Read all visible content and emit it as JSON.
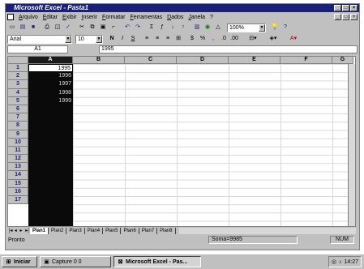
{
  "window": {
    "title": "Microsoft Excel - Pasta1"
  },
  "menu": [
    "Arquivo",
    "Editar",
    "Exibir",
    "Inserir",
    "Formatar",
    "Ferramentas",
    "Dados",
    "Janela",
    "?"
  ],
  "toolbar": {
    "standard_icons": [
      "new-icon",
      "open-icon",
      "save-icon",
      "print-icon",
      "preview-icon",
      "spell-icon",
      "cut-icon",
      "copy-icon",
      "paste-icon",
      "format-painter-icon",
      "undo-icon",
      "redo-icon",
      "autosum-icon",
      "function-icon",
      "sort-asc-icon",
      "sort-desc-icon",
      "chart-wizard-icon",
      "map-icon",
      "drawing-icon"
    ],
    "zoom": "100%",
    "font": "Arial",
    "font_size": "10"
  },
  "formula": {
    "name_box": "A1",
    "value": "1995"
  },
  "columns": [
    "A",
    "B",
    "C",
    "D",
    "E",
    "F",
    "G"
  ],
  "rows": [
    "1",
    "2",
    "3",
    "4",
    "5",
    "6",
    "7",
    "8",
    "9",
    "10",
    "11",
    "12",
    "13",
    "14",
    "15",
    "16",
    "17"
  ],
  "cells_a": [
    "1995",
    "1996",
    "1997",
    "1998",
    "1999"
  ],
  "sheets": [
    "Plan1",
    "Plan2",
    "Plan3",
    "Plan4",
    "Plan5",
    "Plan6",
    "Plan7",
    "Plan8"
  ],
  "status": {
    "left": "Pronto",
    "sum": "Soma=9985",
    "num": "NUM"
  },
  "taskbar": {
    "start": "Iniciar",
    "capture": "Capture 0 0",
    "excel": "Microsoft Excel - Pas...",
    "clock": "14:27"
  },
  "colors": {
    "titlebar": "#1a1f7a",
    "face": "#c0c0c0",
    "selection": "#0a0a0a"
  }
}
